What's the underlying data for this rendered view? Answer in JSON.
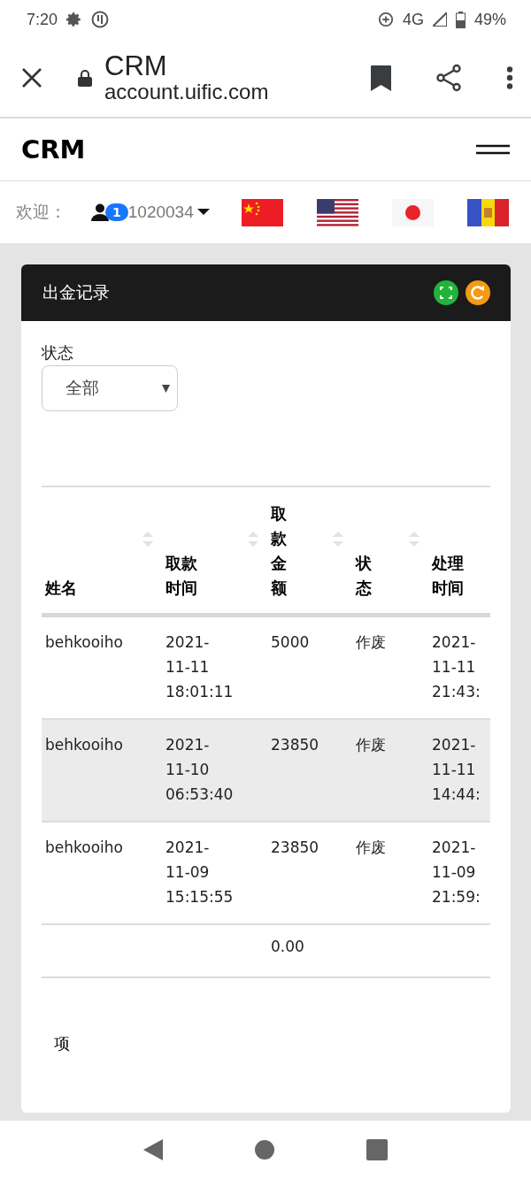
{
  "status_bar": {
    "time": "7:20",
    "network": "4G",
    "battery": "49%"
  },
  "browser": {
    "title": "CRM",
    "url": "account.uific.com"
  },
  "navbar": {
    "brand": "CRM"
  },
  "user_bar": {
    "welcome": "欢迎：",
    "badge": "1",
    "user": "1020034",
    "flags": [
      {
        "kind": "china"
      },
      {
        "kind": "usa"
      },
      {
        "kind": "japan"
      },
      {
        "kind": "andorra"
      }
    ]
  },
  "card": {
    "title": "出金记录",
    "filter": {
      "label": "状态",
      "value": "全部"
    },
    "table": {
      "columns": [
        {
          "label": "姓名",
          "sortable": true
        },
        {
          "label": "取款时间",
          "sortable": true
        },
        {
          "label": "取款金额",
          "sortable": true
        },
        {
          "label": "状态",
          "sortable": true
        },
        {
          "label": "处理时间",
          "sortable": false
        }
      ],
      "rows": [
        {
          "cells": [
            "behkooiho",
            "2021-\n11-11\n18:01:11",
            "5000",
            "作废",
            "2021-\n11-11\n21:43:"
          ],
          "striped": false
        },
        {
          "cells": [
            "behkooiho",
            "2021-\n11-10\n06:53:40",
            "23850",
            "作废",
            "2021-\n11-11\n14:44:"
          ],
          "striped": true
        },
        {
          "cells": [
            "behkooiho",
            "2021-\n11-09\n15:15:55",
            "23850",
            "作废",
            "2021-\n11-09\n21:59:"
          ],
          "striped": false
        }
      ],
      "footer": {
        "amount": "0.00"
      }
    },
    "info": "项"
  }
}
